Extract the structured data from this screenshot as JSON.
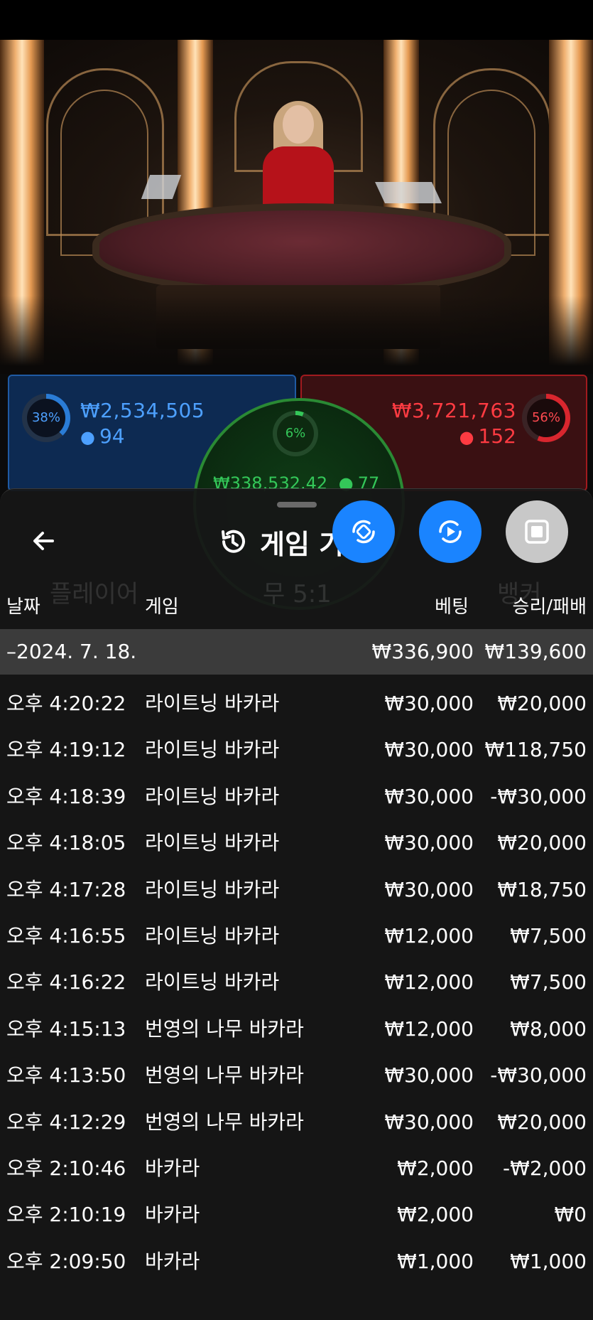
{
  "video": {
    "table_labels": [
      "PLAYER",
      "BANKER"
    ]
  },
  "bets": {
    "player": {
      "percent": "38%",
      "amount": "₩2,534,505",
      "count": "94",
      "percent_value": 38
    },
    "banker": {
      "percent": "56%",
      "amount": "₩3,721,763",
      "count": "152",
      "percent_value": 56
    },
    "tie": {
      "percent": "6%",
      "amount": "₩338,532.42",
      "count": "77",
      "percent_value": 6
    }
  },
  "sheet": {
    "title": "게임 기록",
    "columns": {
      "date": "날짜",
      "game": "게임",
      "bet": "베팅",
      "winloss": "승리/패배"
    },
    "date_group": {
      "label": "–2024. 7. 18.",
      "bet_total": "₩336,900",
      "win_total": "₩139,600"
    },
    "rows": [
      {
        "time": "오후 4:20:22",
        "game": "라이트닝 바카라",
        "bet": "₩30,000",
        "win": "₩20,000"
      },
      {
        "time": "오후 4:19:12",
        "game": "라이트닝 바카라",
        "bet": "₩30,000",
        "win": "₩118,750"
      },
      {
        "time": "오후 4:18:39",
        "game": "라이트닝 바카라",
        "bet": "₩30,000",
        "win": "-₩30,000"
      },
      {
        "time": "오후 4:18:05",
        "game": "라이트닝 바카라",
        "bet": "₩30,000",
        "win": "₩20,000"
      },
      {
        "time": "오후 4:17:28",
        "game": "라이트닝 바카라",
        "bet": "₩30,000",
        "win": "₩18,750"
      },
      {
        "time": "오후 4:16:55",
        "game": "라이트닝 바카라",
        "bet": "₩12,000",
        "win": "₩7,500"
      },
      {
        "time": "오후 4:16:22",
        "game": "라이트닝 바카라",
        "bet": "₩12,000",
        "win": "₩7,500"
      },
      {
        "time": "오후 4:15:13",
        "game": "번영의 나무 바카라",
        "bet": "₩12,000",
        "win": "₩8,000"
      },
      {
        "time": "오후 4:13:50",
        "game": "번영의 나무 바카라",
        "bet": "₩30,000",
        "win": "-₩30,000"
      },
      {
        "time": "오후 4:12:29",
        "game": "번영의 나무 바카라",
        "bet": "₩30,000",
        "win": "₩20,000"
      },
      {
        "time": "오후 2:10:46",
        "game": "바카라",
        "bet": "₩2,000",
        "win": "-₩2,000"
      },
      {
        "time": "오후 2:10:19",
        "game": "바카라",
        "bet": "₩2,000",
        "win": "₩0"
      },
      {
        "time": "오후 2:09:50",
        "game": "바카라",
        "bet": "₩1,000",
        "win": "₩1,000"
      }
    ]
  },
  "background_ghost": {
    "player_label": "플레이어",
    "tie_label": "무 5:1",
    "banker_label": "뱅커"
  },
  "colors": {
    "accent_blue": "#1a84ff",
    "player_blue": "#4da0ff",
    "banker_red": "#ff3b42",
    "tie_green": "#34c759"
  },
  "icons": [
    "back-arrow-icon",
    "history-icon",
    "rotate-screen-icon",
    "replay-icon",
    "stop-icon",
    "person-icon"
  ]
}
